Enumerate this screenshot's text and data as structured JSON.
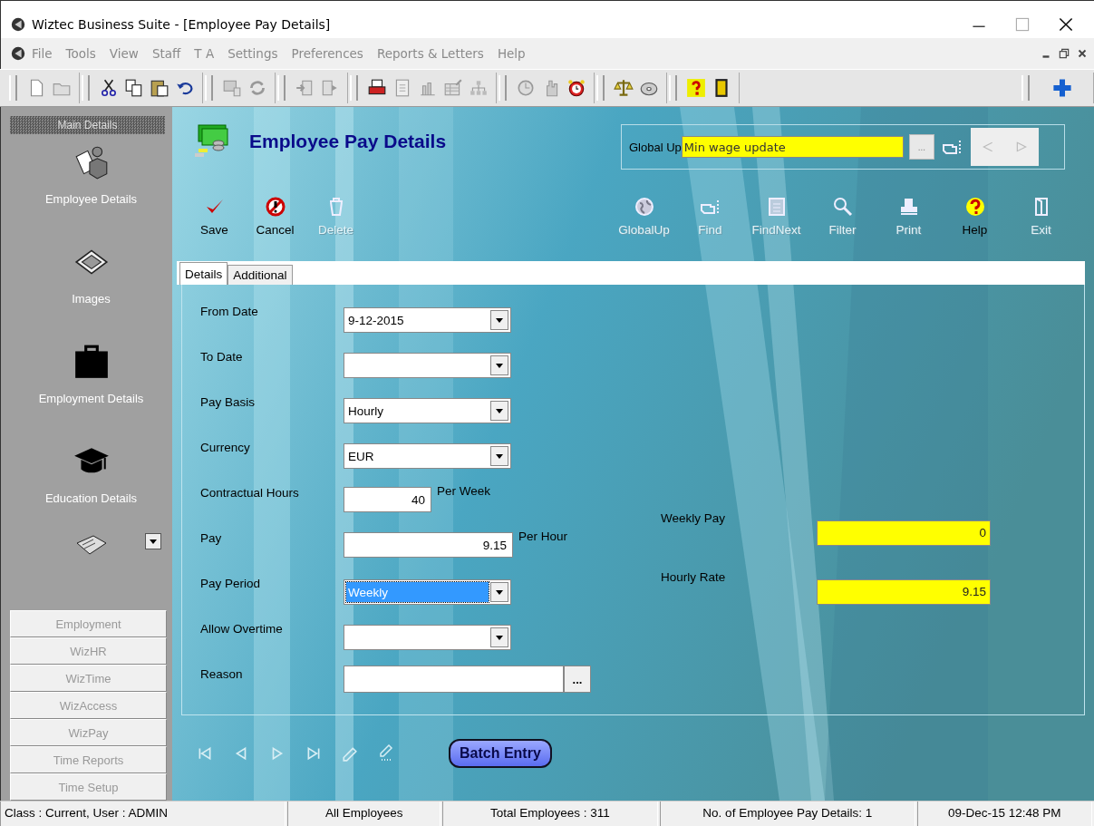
{
  "window": {
    "title": "Wiztec Business Suite - [Employee Pay Details]"
  },
  "menu": [
    "File",
    "Tools",
    "View",
    "Staff",
    "T A",
    "Settings",
    "Preferences",
    "Reports & Letters",
    "Help"
  ],
  "sidebar": {
    "header": "Main Details",
    "items": [
      {
        "label": "Employee Details",
        "kind": "person"
      },
      {
        "label": "Images",
        "kind": "photos"
      },
      {
        "label": "Employment Details",
        "kind": "briefcase"
      },
      {
        "label": "Education Details",
        "kind": "cap"
      }
    ],
    "modules": [
      "Employment",
      "WizHR",
      "WizTime",
      "WizAccess",
      "WizPay",
      "Time Reports",
      "Time Setup"
    ]
  },
  "page": {
    "title": "Employee Pay Details"
  },
  "global_update": {
    "label": "Global Up",
    "value": "Min wage update",
    "browse": "..."
  },
  "actions": [
    {
      "label": "Save",
      "kind": "save",
      "disabled": false
    },
    {
      "label": "Cancel",
      "kind": "cancel",
      "disabled": false
    },
    {
      "label": "Delete",
      "kind": "delete",
      "disabled": true
    },
    {
      "label": "GlobalUp",
      "kind": "globe",
      "disabled": true
    },
    {
      "label": "Find",
      "kind": "find",
      "disabled": true
    },
    {
      "label": "FindNext",
      "kind": "findnext",
      "disabled": true
    },
    {
      "label": "Filter",
      "kind": "filter",
      "disabled": true
    },
    {
      "label": "Print",
      "kind": "print",
      "disabled": true
    },
    {
      "label": "Help",
      "kind": "help",
      "disabled": false
    },
    {
      "label": "Exit",
      "kind": "exit",
      "disabled": true
    }
  ],
  "tabs": [
    {
      "label": "Details",
      "selected": true
    },
    {
      "label": "Additional",
      "selected": false
    }
  ],
  "form": {
    "fields": [
      {
        "label": "From Date",
        "kind": "dropdown",
        "value": "9-12-2015",
        "focused": false
      },
      {
        "label": "To Date",
        "kind": "dropdown",
        "focused": false
      },
      {
        "label": "Pay Basis",
        "kind": "dropdown",
        "value": "Hourly",
        "focused": false
      },
      {
        "label": "Currency",
        "kind": "dropdown",
        "value": "EUR",
        "focused": false
      },
      {
        "label": "Contractual Hours",
        "kind": "short-number",
        "value": "40",
        "unit": "Per Week",
        "focused": false
      },
      {
        "label": "Pay",
        "kind": "number",
        "value": "9.15",
        "unit": "Per Hour",
        "focused": false
      },
      {
        "label": "Pay Period",
        "kind": "dropdown",
        "value": "Weekly",
        "focused": true
      },
      {
        "label": "Allow Overtime",
        "kind": "dropdown",
        "focused": false
      },
      {
        "label": "Reason",
        "kind": "lookup",
        "button": "...",
        "focused": false
      }
    ],
    "totals": [
      {
        "label": "Weekly Pay",
        "value": "0"
      },
      {
        "label": "Hourly Rate",
        "value": "9.15"
      }
    ]
  },
  "batch_button": "Batch Entry",
  "status_bar": [
    "Class : Current, User : ADMIN",
    "All Employees",
    "Total Employees : 311",
    "No. of Employee Pay Details: 1",
    "09-Dec-15 12:48 PM"
  ]
}
